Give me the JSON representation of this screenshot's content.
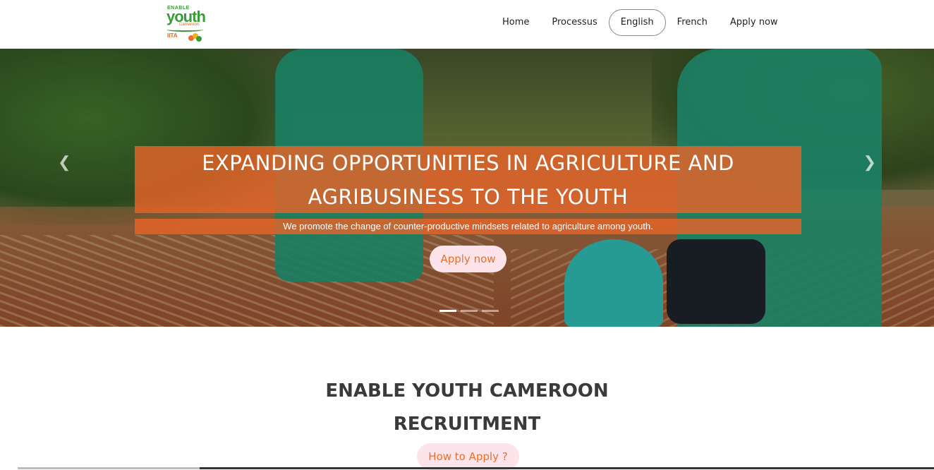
{
  "logo": {
    "line1": "ENABLE",
    "line2": "youth",
    "line3": "Cameroon",
    "partner": "IITA"
  },
  "nav": {
    "items": [
      {
        "label": "Home",
        "active": false
      },
      {
        "label": "Processus",
        "active": false
      },
      {
        "label": "English",
        "active": true
      },
      {
        "label": "French",
        "active": false
      },
      {
        "label": "Apply now",
        "active": false
      }
    ]
  },
  "hero": {
    "headline_line1": "EXPANDING OPPORTUNITIES IN AGRICULTURE AND",
    "headline_line2": "AGRIBUSINESS TO THE YOUTH",
    "subtitle": "We promote the change of counter-productive mindsets related to agriculture among youth.",
    "cta_label": "Apply now",
    "prev_icon": "chevron-left-icon",
    "next_icon": "chevron-right-icon",
    "slides": 3,
    "active_slide": 1
  },
  "section": {
    "title_line1": "ENABLE YOUTH CAMEROON",
    "title_line2": "RECRUITMENT",
    "how_label": "How to Apply ?"
  },
  "colors": {
    "accent": "#e8702a",
    "button_bg": "#fde4ea",
    "brand_green": "#3a9b3a"
  }
}
